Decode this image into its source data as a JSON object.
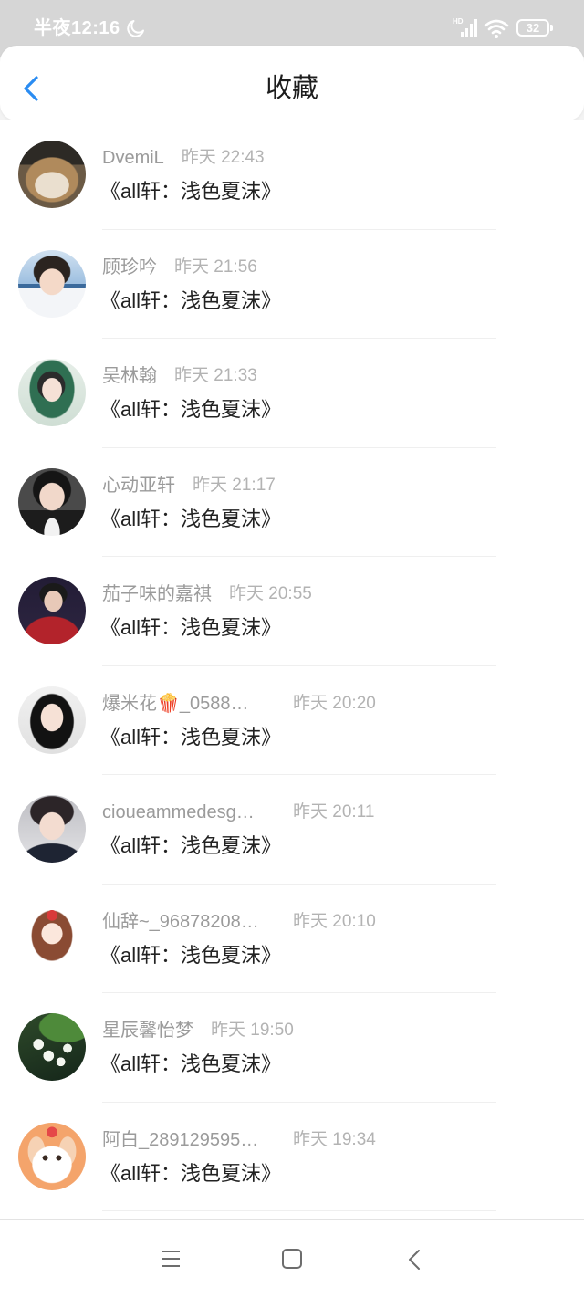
{
  "theme": {
    "accent": "#2a8cf2"
  },
  "status_bar": {
    "time": "半夜12:16",
    "dnd_icon": "moon-icon",
    "hd_label": "HD",
    "signal_icon": "signal-icon",
    "wifi_icon": "wifi-icon",
    "battery_icon": "battery-icon",
    "battery_level": "32"
  },
  "header": {
    "back_icon": "chevron-left-icon",
    "title": "收藏"
  },
  "items": [
    {
      "name": "DvemiL",
      "time": "昨天 22:43",
      "title": "《all轩：浅色夏沫》"
    },
    {
      "name": "顾珍吟",
      "time": "昨天 21:56",
      "title": "《all轩：浅色夏沫》"
    },
    {
      "name": "吴林翰",
      "time": "昨天 21:33",
      "title": "《all轩：浅色夏沫》"
    },
    {
      "name": "心动亚轩",
      "time": "昨天 21:17",
      "title": "《all轩：浅色夏沫》"
    },
    {
      "name": "茄子味的嘉祺",
      "time": "昨天 20:55",
      "title": "《all轩：浅色夏沫》"
    },
    {
      "name": "爆米花🍿_0588…",
      "time": "昨天 20:20",
      "title": "《all轩：浅色夏沫》"
    },
    {
      "name": "cioueammedesg…",
      "time": "昨天 20:11",
      "title": "《all轩：浅色夏沫》"
    },
    {
      "name": "仙辞~_96878208…",
      "time": "昨天 20:10",
      "title": "《all轩：浅色夏沫》"
    },
    {
      "name": "星辰馨怡梦",
      "time": "昨天 19:50",
      "title": "《all轩：浅色夏沫》"
    },
    {
      "name": "阿白_289129595…",
      "time": "昨天 19:34",
      "title": "《all轩：浅色夏沫》"
    }
  ],
  "nav_bar": {
    "menu_icon": "menu-icon",
    "home_icon": "square-icon",
    "back_icon": "back-arrow-icon"
  }
}
